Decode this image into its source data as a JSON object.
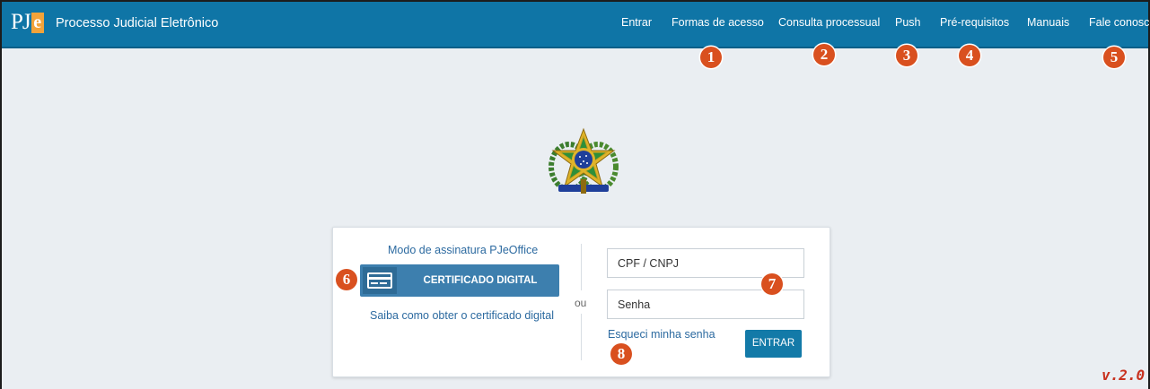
{
  "header": {
    "logo_pj": "PJ",
    "logo_e": "e",
    "title": "Processo Judicial Eletrônico",
    "nav": [
      {
        "label": "Entrar"
      },
      {
        "label": "Formas de acesso"
      },
      {
        "label": "Consulta processual"
      },
      {
        "label": "Push"
      },
      {
        "label": "Pré-requisitos"
      },
      {
        "label": "Manuais"
      },
      {
        "label": "Fale conosco"
      }
    ]
  },
  "badges": [
    "1",
    "2",
    "3",
    "4",
    "5",
    "6",
    "7",
    "8"
  ],
  "emblem": {
    "icon": "brazil-coat-of-arms-icon"
  },
  "login": {
    "signature_mode_link": "Modo de assinatura PJeOffice",
    "certificate_button": "CERTIFICADO DIGITAL",
    "certificate_icon": "credit-card-icon",
    "certificate_help_link": "Saiba como obter o certificado digital",
    "separator": "ou",
    "cpf_placeholder": "CPF / CNPJ",
    "password_placeholder": "Senha",
    "forgot_link": "Esqueci minha senha",
    "submit_button": "ENTRAR"
  },
  "version": "v.2.0",
  "colors": {
    "header_bg": "#0f75a6",
    "page_bg": "#eaeef2",
    "badge": "#d9501f",
    "link": "#2c6aa0",
    "version_text": "#c8311e"
  }
}
